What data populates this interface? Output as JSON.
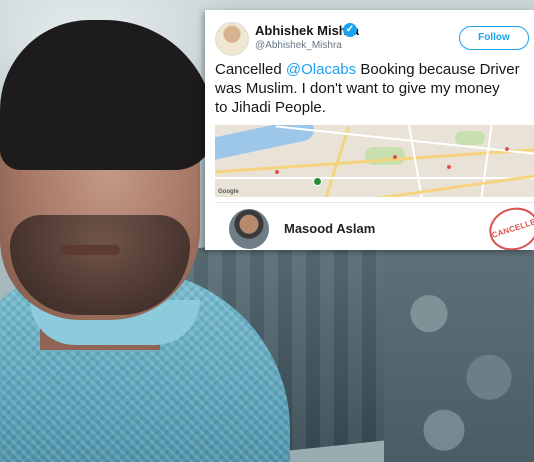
{
  "tweet": {
    "author_name": "Abhishek Mishra",
    "handle": "@Abhishek_Mishra",
    "follow_label": "Follow",
    "text_line1_prefix": "Cancelled ",
    "text_mention": "@Olacabs",
    "text_line1_suffix": " Booking because Driver",
    "text_line2": "was Muslim. I don't want to give my money",
    "text_line3": "to Jihadi People.",
    "verified_glyph": "✓"
  },
  "booking_card": {
    "driver_name": "Masood Aslam",
    "stamp_text": "CANCELLED",
    "map_attribution": "Google"
  },
  "icons": {
    "verified": "verified-badge-icon",
    "map_pin": "map-pin-icon"
  },
  "colors": {
    "accent": "#1da1f2",
    "stamp": "#d9534f"
  }
}
